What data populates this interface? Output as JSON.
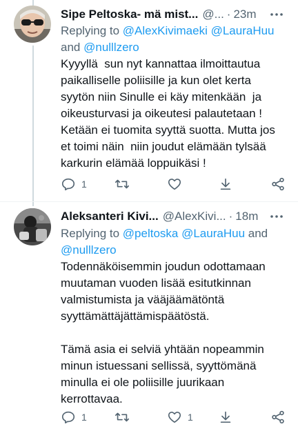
{
  "tweets": [
    {
      "name": "Sipe Peltoska- mä mist...",
      "handle": "@...",
      "dot": "·",
      "time": "23m",
      "reply_prefix": "Replying to",
      "reply_mentions_line1": "@AlexKivimaeki @LauraHuu",
      "reply_and": "and",
      "reply_mention_last": "@nulllzero",
      "body": "Kyyyllä  sun nyt kannattaa ilmoittautua paikalliselle poliisille ja kun olet kerta syytön niin Sinulle ei käy mitenkään  ja oikeusturvasi ja oikeutesi palautetaan ! Ketään ei tuomita syyttä suotta. Mutta jos et toimi näin  niin joudut elämään tylsää karkurin elämää loppuikäsi !",
      "reply_count": "1",
      "retweet_count": "",
      "like_count": ""
    },
    {
      "name": "Aleksanteri Kivi...",
      "handle": "@AlexKivi...",
      "dot": "·",
      "time": "18m",
      "reply_prefix": "Replying to",
      "reply_mentions_line1": "@peltoska @LauraHuu",
      "reply_and": "and",
      "reply_mention_last": "@nulllzero",
      "body": "Todennäköisemmin joudun odottamaan muutaman vuoden lisää esitutkinnan valmistumista ja vääjäämätöntä syyttämättäjättämispäätöstä.\n\nTämä asia ei selviä yhtään nopeammin minun istuessani sellissä, syyttömänä minulla ei ole poliisille juurikaan kerrottavaa.",
      "reply_count": "1",
      "retweet_count": "",
      "like_count": "1"
    }
  ],
  "colors": {
    "text": "#0f1419",
    "secondary": "#536471",
    "link": "#1d9bf0",
    "thread_line": "#cfd9de"
  }
}
